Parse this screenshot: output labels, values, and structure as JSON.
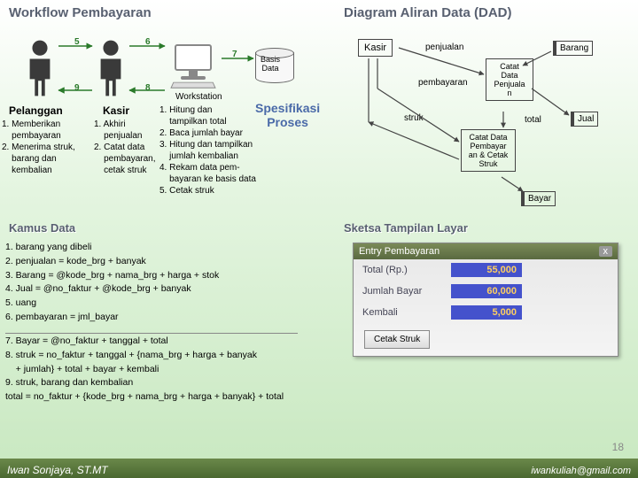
{
  "workflow": {
    "heading": "Workflow Pembayaran",
    "pelanggan": {
      "label": "Pelanggan",
      "steps": "1. Memberikan\n    pembayaran\n2. Menerima struk,\n    barang dan\n    kembalian"
    },
    "kasir": {
      "label": "Kasir",
      "steps": "1. Akhiri\n    penjualan\n2. Catat data\n    pembayaran,\n    cetak struk"
    },
    "ws": {
      "label": "Workstation"
    },
    "db": {
      "label": "Basis\nData"
    },
    "spes": {
      "title": "Spesifikasi\nProses",
      "steps": "1. Hitung dan\n    tampilkan total\n2. Baca jumlah bayar\n3. Hitung dan tampilkan\n    jumlah kembalian\n4. Rekam data pem-\n    bayaran ke basis data\n5. Cetak struk"
    },
    "arrows": {
      "a5": "5",
      "a6": "6",
      "a7": "7",
      "a8": "8",
      "a9": "9"
    }
  },
  "dad": {
    "heading": "Diagram Aliran Data (DAD)",
    "kasir": "Kasir",
    "penjualan_flow": "penjualan",
    "barang_store": "Barang",
    "pembayaran_flow": "pembayaran",
    "struk_flow": "struk",
    "proc_catat": "Catat\nData\nPenjuala\nn",
    "total_flow": "total",
    "jual_store": "Jual",
    "proc_pembayar": "Catat Data\nPembayar\nan & Cetak\nStruk",
    "bayar_store": "Bayar"
  },
  "kamus": {
    "heading": "Kamus Data",
    "items": [
      "1. barang yang dibeli",
      "2. penjualan =  kode_brg + banyak",
      "3. Barang = @kode_brg + nama_brg + harga + stok",
      "4. Jual = @no_faktur + @kode_brg + banyak",
      "5. uang",
      "6. pembayaran =  jml_bayar"
    ],
    "items2": [
      "7. Bayar = @no_faktur + tanggal + total",
      "8. struk = no_faktur + tanggal + {nama_brg + harga + banyak\n    + jumlah} + total + bayar + kembali",
      "9. struk, barang dan kembalian",
      "total = no_faktur + {kode_brg + nama_brg + harga + banyak} + total"
    ]
  },
  "sketsa": {
    "heading": "Sketsa Tampilan Layar",
    "title": "Entry Pembayaran",
    "close": "x",
    "rows": [
      {
        "label": "Total (Rp.)",
        "value": "55,000"
      },
      {
        "label": "Jumlah Bayar",
        "value": "60,000"
      },
      {
        "label": "Kembali",
        "value": "5,000"
      }
    ],
    "button": "Cetak Struk"
  },
  "footer": {
    "name": "Iwan Sonjaya, ST.MT",
    "mail": "iwankuliah@gmail.com",
    "page": "18"
  }
}
